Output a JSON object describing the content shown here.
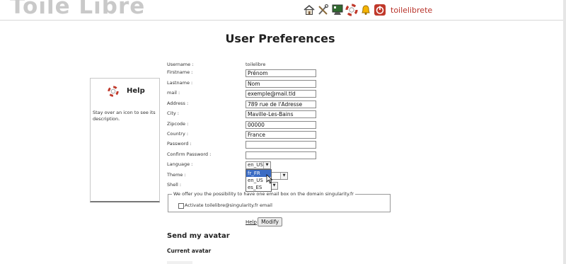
{
  "header": {
    "logo_text": "Toile Libre",
    "toolbar_icons": [
      "home-icon",
      "tools-icon",
      "admin-icon",
      "help-lifebuoy-icon",
      "notification-bell-icon",
      "power-icon"
    ],
    "username": "toilelibrete"
  },
  "page": {
    "title": "User Preferences"
  },
  "help_panel": {
    "title": "Help",
    "text": "Stay over an icon to see its description."
  },
  "form": {
    "username": {
      "label": "Username :",
      "value": "toilelibre"
    },
    "firstname": {
      "label": "Firstname :",
      "value": "Prénom"
    },
    "lastname": {
      "label": "Lastname :",
      "value": "Nom"
    },
    "mail": {
      "label": "mail :",
      "value": "exemple@mail.tld"
    },
    "address": {
      "label": "Address :",
      "value": "789 rue de l'Adresse"
    },
    "city": {
      "label": "City :",
      "value": "Maville-Les-Bains"
    },
    "zipcode": {
      "label": "Zipcode :",
      "value": "00000"
    },
    "country": {
      "label": "Country :",
      "value": "France"
    },
    "password": {
      "label": "Password :",
      "value": ""
    },
    "confirm_password": {
      "label": "Confirm Password :",
      "value": ""
    },
    "language": {
      "label": "Language :",
      "value": "en_US",
      "options": [
        "fr_FR",
        "en_US",
        "es_ES"
      ],
      "highlighted": "fr_FR"
    },
    "theme": {
      "label": "Theme :"
    },
    "shell": {
      "label": "Shell :"
    },
    "email_box": {
      "legend": "We offer you the possibility to have one email box on the domain singularity.fr",
      "checkbox_label": "Activate toilelibre@singularity.fr email",
      "checked": false
    },
    "help_link": "Help",
    "modify_label": "Modify"
  },
  "avatar": {
    "title": "Send my avatar",
    "current_label": "Current avatar"
  },
  "colors": {
    "username_link": "#b8332a",
    "dropdown_highlight": "#3b6cc4"
  }
}
